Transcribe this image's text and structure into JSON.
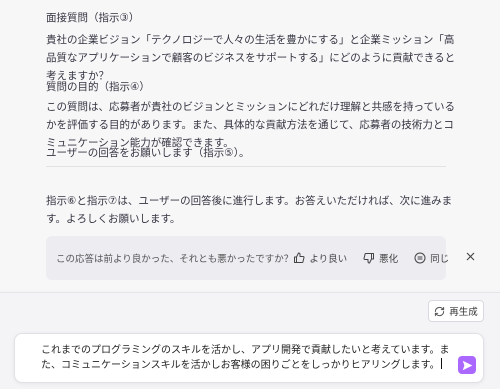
{
  "response": {
    "interview_title": "面接質問（指示③）",
    "question_text": "貴社の企業ビジョン「テクノロジーで人々の生活を豊かにする」と企業ミッション「高品質なアプリケーションで顧客のビジネスをサポートする」にどのように貢献できると考えますか？",
    "purpose_title": "質問の目的（指示④）",
    "purpose_text": "この質問は、応募者が貴社のビジョンとミッションにどれだけ理解と共感を持っているかを評価する目的があります。また、具体的な貢献方法を通じて、応募者の技術力とコミュニケーション能力が確認できます。",
    "request_text": "ユーザーの回答をお願いします（指示⑤）。",
    "note_text": "指示⑥と指示⑦は、ユーザーの回答後に進行します。お答えいただければ、次に進みます。よろしくお願いします。"
  },
  "feedback": {
    "question": "この応答は前より良かった、それとも悪かったですか？",
    "better_label": "より良い",
    "worse_label": "悪化",
    "same_label": "同じ"
  },
  "regenerate_label": "再生成",
  "composer": {
    "text": "これまでのプログラミングのスキルを活かし、アプリ開発で貢献したいと考えています。また、コミュニケーションスキルを活かしお客様の困りごとをしっかりヒアリングします。"
  },
  "colors": {
    "send_button": "#ab68ff",
    "feedback_bg": "#ececf1"
  }
}
